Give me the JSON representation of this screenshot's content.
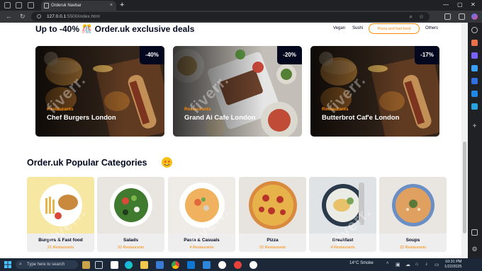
{
  "browser": {
    "tab_title": "Orderuk Navbar",
    "tab_close": "×",
    "new_tab": "+",
    "url_host": "127.0.0.1",
    "url_path": ":5500/index.html",
    "win_min": "—",
    "win_max": "▢",
    "win_close": "✕"
  },
  "deals": {
    "title": "Up to -40% 🎊 Order.uk exclusive deals",
    "filters": [
      "Vegan",
      "Sushi",
      "Pizza and fast food",
      "Others"
    ],
    "active_filter_index": 2,
    "cards": [
      {
        "category": "Restaurants",
        "name": "Chef Burgers London",
        "discount": "-40%"
      },
      {
        "category": "Restaurants",
        "name": "Grand Ai Cafe London",
        "discount": "-20%"
      },
      {
        "category": "Restaurants",
        "name": "Butterbrot Caf'e London",
        "discount": "-17%"
      }
    ]
  },
  "categories": {
    "title": "Order.uk Popular Categories",
    "items": [
      {
        "name": "Burgers & Fast food",
        "count": "21 Restaurants"
      },
      {
        "name": "Salads",
        "count": "32 Restaurants"
      },
      {
        "name": "Pasta & Casuals",
        "count": "4 Restaurants"
      },
      {
        "name": "Pizza",
        "count": "32 Restaurants"
      },
      {
        "name": "Breakfast",
        "count": "4 Restaurants"
      },
      {
        "name": "Soups",
        "count": "32 Restaurants"
      }
    ]
  },
  "watermark_text": "fiverr.",
  "taskbar": {
    "search_placeholder": "Type here to search",
    "weather": "14°C  Smoke",
    "time": "10:31 PM",
    "date": "1/22/2025"
  },
  "colors": {
    "accent": "#FC8A06",
    "dark": "#03081F"
  }
}
